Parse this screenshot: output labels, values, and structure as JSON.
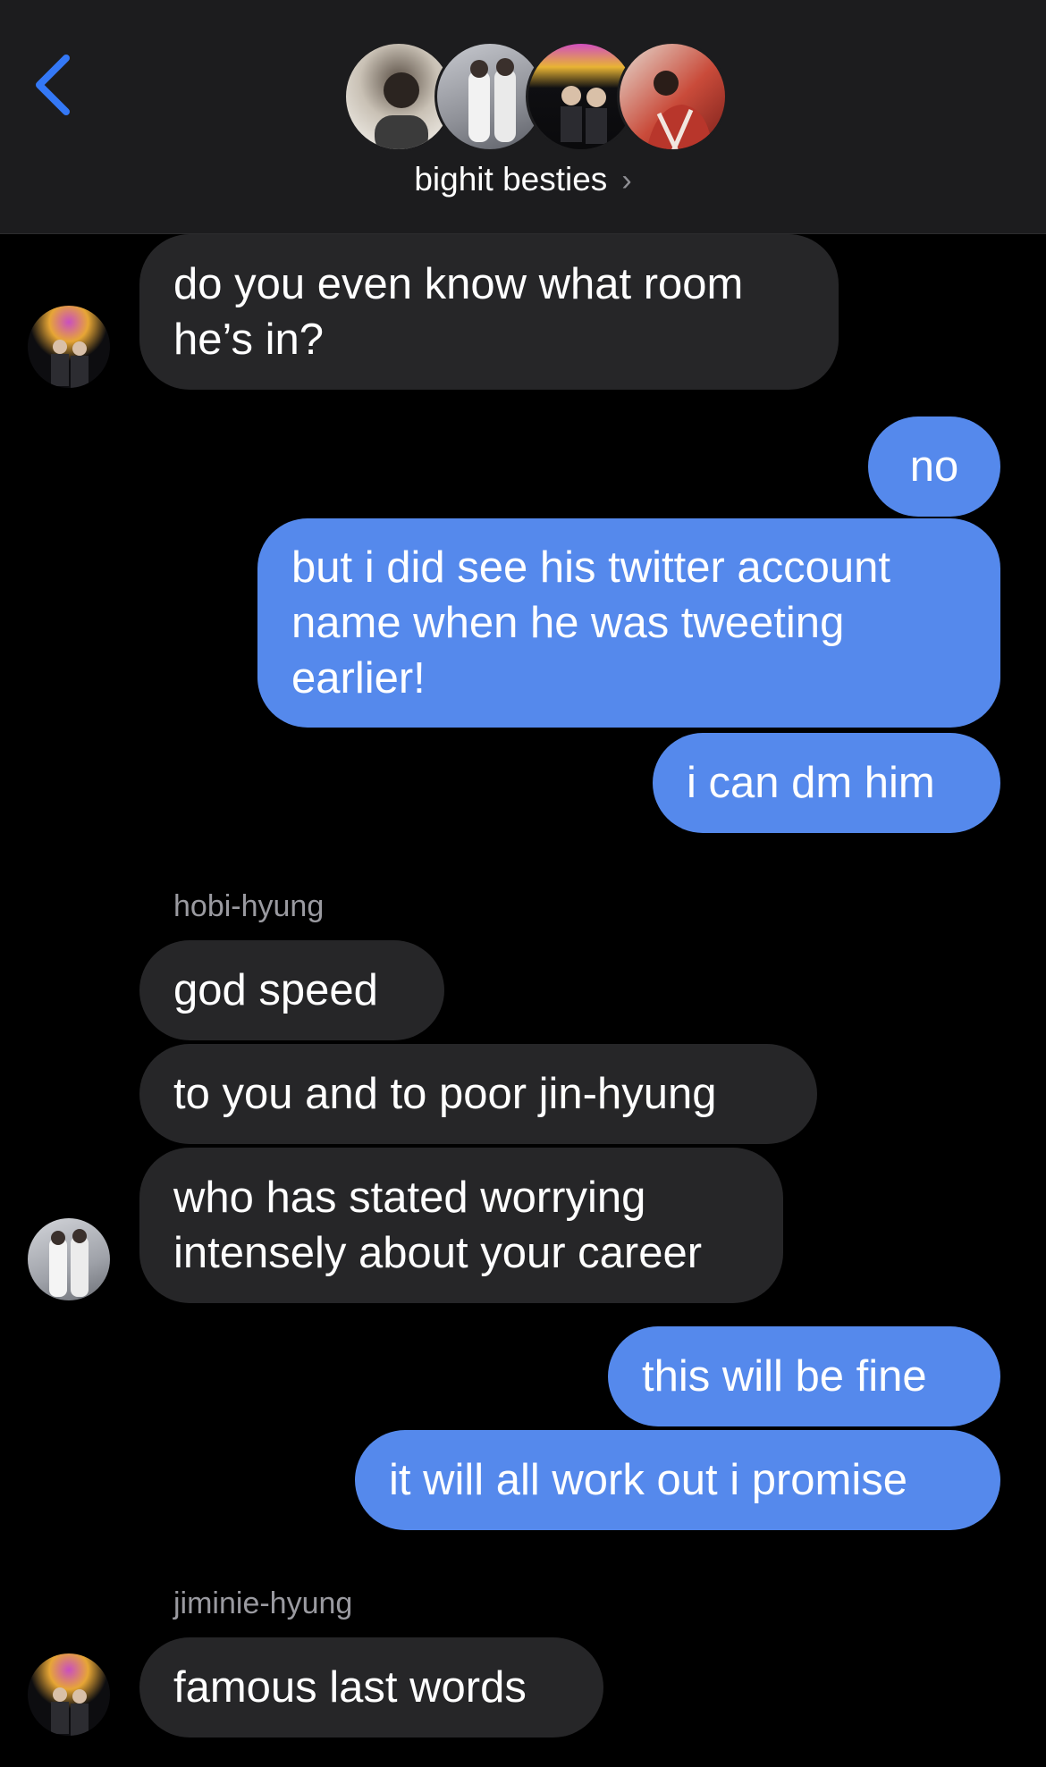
{
  "header": {
    "back_label": "back",
    "group_name": "bighit besties",
    "chevron": "›"
  },
  "messages": [
    {
      "text_lines": [
        "do you even know what room",
        "he’s in?"
      ]
    },
    {
      "text": "no"
    },
    {
      "text_lines": [
        "but i did see his twitter account",
        "name when he was tweeting",
        "earlier!"
      ]
    },
    {
      "text": "i can dm him"
    },
    {
      "sender": "hobi-hyung"
    },
    {
      "text": "god speed"
    },
    {
      "text": "to you and to poor jin-hyung"
    },
    {
      "text_lines": [
        "who has stated worrying",
        "intensely about your career"
      ]
    },
    {
      "text": "this will be fine"
    },
    {
      "text": "it will all work out i promise"
    },
    {
      "sender": "jiminie-hyung"
    },
    {
      "text": "famous last words"
    }
  ],
  "colors": {
    "accent": "#3478f6",
    "sent_bubble": "#5589ec",
    "received_bubble": "#262628",
    "header_bg": "#1c1c1e",
    "background": "#000000",
    "sender_label": "#9a9aa0"
  }
}
